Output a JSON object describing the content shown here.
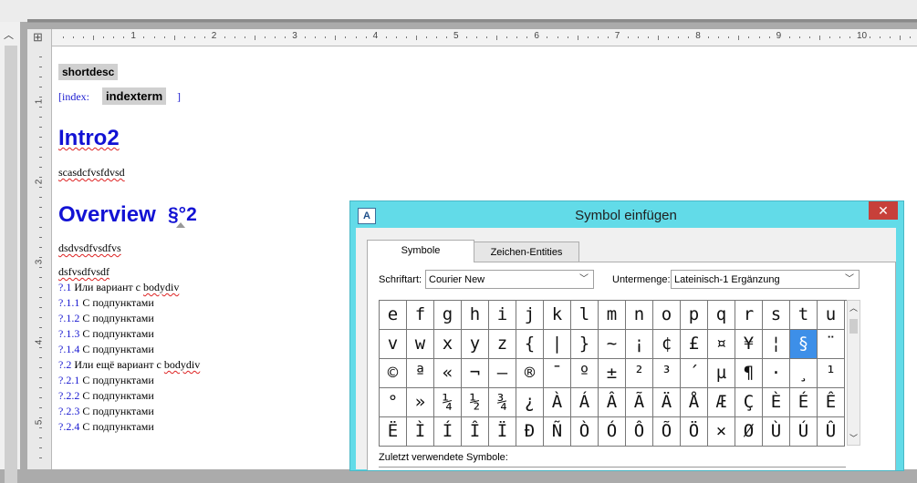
{
  "ruler": {
    "numbers": [
      "1",
      "2",
      "3",
      "4",
      "5",
      "6",
      "7",
      "8",
      "9",
      "10"
    ],
    "vnumbers": [
      "1",
      "2",
      "3",
      "4",
      "5"
    ]
  },
  "document": {
    "shortdesc": "shortdesc",
    "index_prefix": "[index:",
    "indexterm": "indexterm",
    "index_suffix": "]",
    "intro_heading": "Intro2",
    "intro_text": "scasdcfvsfdvsd",
    "overview_heading": "Overview",
    "overview_mark": "§°2",
    "para1": "dsdvsdfvsdfvs",
    "para2": "dsfvsdfvsdf",
    "list": [
      {
        "num": "?.1",
        "text": "Или вариант с ",
        "tail": "bodydiv"
      },
      {
        "num": "?.1.1",
        "text": "С подпунктами",
        "tail": ""
      },
      {
        "num": "?.1.2",
        "text": "С подпунктами",
        "tail": ""
      },
      {
        "num": "?.1.3",
        "text": "С подпунктами",
        "tail": ""
      },
      {
        "num": "?.1.4",
        "text": "С подпунктами",
        "tail": ""
      },
      {
        "num": "?.2",
        "text": "Или ещё вариант с ",
        "tail": "bodydiv"
      },
      {
        "num": "?.2.1",
        "text": "С подпунктами",
        "tail": ""
      },
      {
        "num": "?.2.2",
        "text": "С подпунктами",
        "tail": ""
      },
      {
        "num": "?.2.3",
        "text": "С подпунктами",
        "tail": ""
      },
      {
        "num": "?.2.4",
        "text": "С подпунктами",
        "tail": ""
      }
    ]
  },
  "dialog": {
    "icon": "A",
    "title": "Symbol einfügen",
    "close": "✕",
    "tabs": [
      "Symbole",
      "Zeichen-Entities"
    ],
    "font_label": "Schriftart:",
    "font_value": "Courier New",
    "subset_label": "Untermenge:",
    "subset_value": "Lateinisch-1 Ergänzung",
    "recent_label": "Zuletzt verwendete Symbole:",
    "selected_symbol": "§",
    "symbols": [
      [
        "e",
        "f",
        "g",
        "h",
        "i",
        "j",
        "k",
        "l",
        "m",
        "n",
        "o",
        "p",
        "q",
        "r",
        "s",
        "t",
        "u"
      ],
      [
        "v",
        "w",
        "x",
        "y",
        "z",
        "{",
        "|",
        "}",
        "~",
        "¡",
        "¢",
        "£",
        "¤",
        "¥",
        "¦",
        "§",
        "¨"
      ],
      [
        "©",
        "ª",
        "«",
        "¬",
        "–",
        "®",
        "¯",
        "º",
        "±",
        "²",
        "³",
        "´",
        "µ",
        "¶",
        "·",
        "¸",
        "¹"
      ],
      [
        "°",
        "»",
        "¼",
        "½",
        "¾",
        "¿",
        "À",
        "Á",
        "Â",
        "Ã",
        "Ä",
        "Å",
        "Æ",
        "Ç",
        "È",
        "É",
        "Ê"
      ],
      [
        "Ë",
        "Ì",
        "Í",
        "Î",
        "Ï",
        "Ð",
        "Ñ",
        "Ò",
        "Ó",
        "Ô",
        "Õ",
        "Ö",
        "×",
        "Ø",
        "Ù",
        "Ú",
        "Û"
      ]
    ]
  },
  "icons": {
    "scroll_up": "chevron-up-icon",
    "dropdown": "chevron-down-icon",
    "table_grid": "table-grid-icon"
  },
  "colors": {
    "heading": "#1212d4",
    "dialog_title_bar": "#62dbe8",
    "close": "#c7403a",
    "selected": "#3d8fe8"
  }
}
